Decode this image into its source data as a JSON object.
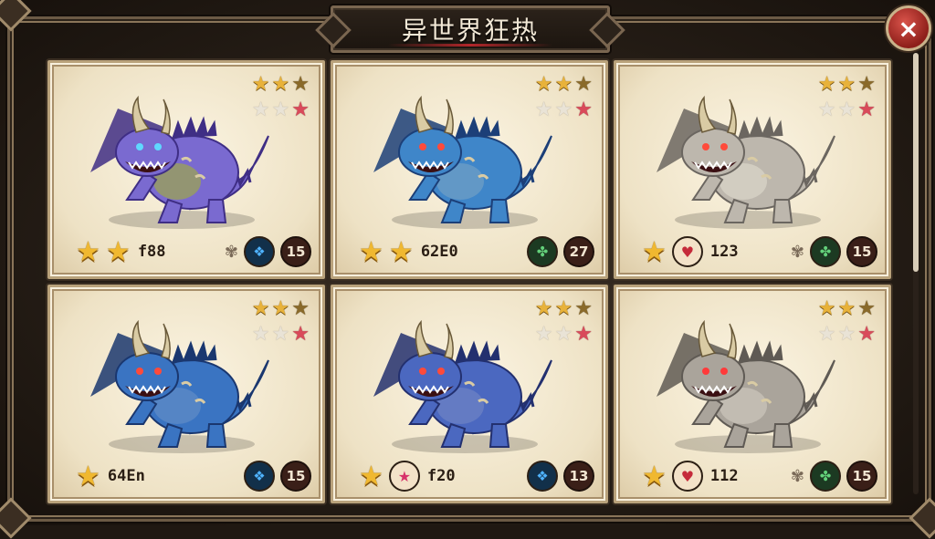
{
  "title": "异世界狂热",
  "close_icon": "×",
  "cards": [
    {
      "body": "#7a6ad0",
      "dark": "#3f2e85",
      "belly": "#9aa05a",
      "eye": "#5fd8ff",
      "top_rows": [
        [
          "gold",
          "gold",
          "dark"
        ],
        [
          "blank",
          "blank",
          "red"
        ]
      ],
      "bottom_stars": 2,
      "special_icon": null,
      "code": "f88",
      "leaf": true,
      "element": "blue",
      "element_glyph": "❖",
      "level": "15"
    },
    {
      "body": "#3f86c9",
      "dark": "#1c3f78",
      "belly": "#6c9cc6",
      "eye": "#ff4a3a",
      "top_rows": [
        [
          "gold",
          "gold",
          "dark"
        ],
        [
          "blank",
          "blank",
          "red"
        ]
      ],
      "bottom_stars": 2,
      "special_icon": null,
      "code": "62E0",
      "leaf": false,
      "element": "green",
      "element_glyph": "✤",
      "level": "27"
    },
    {
      "body": "#bdb7ad",
      "dark": "#6b6660",
      "belly": "#d7d2c6",
      "eye": "#ff4a3a",
      "top_rows": [
        [
          "gold",
          "gold",
          "dark"
        ],
        [
          "blank",
          "blank",
          "red"
        ]
      ],
      "bottom_stars": 1,
      "special_icon": "heart",
      "code": "123",
      "leaf": true,
      "element": "green",
      "element_glyph": "✤",
      "level": "15"
    },
    {
      "body": "#3a74c2",
      "dark": "#1a376f",
      "belly": "#5d89c5",
      "eye": "#ff4a3a",
      "top_rows": [
        [
          "gold",
          "gold",
          "dark"
        ],
        [
          "blank",
          "blank",
          "red"
        ]
      ],
      "bottom_stars": 1,
      "special_icon": null,
      "code": "64En",
      "leaf": false,
      "element": "blue",
      "element_glyph": "❖",
      "level": "15"
    },
    {
      "body": "#4b68c0",
      "dark": "#23306f",
      "belly": "#6a7fc3",
      "eye": "#ff4a3a",
      "top_rows": [
        [
          "gold",
          "gold",
          "dark"
        ],
        [
          "blank",
          "blank",
          "red"
        ]
      ],
      "bottom_stars": 1,
      "special_icon": "pinkstar",
      "code": "f20",
      "leaf": false,
      "element": "blue",
      "element_glyph": "❖",
      "level": "13"
    },
    {
      "body": "#aaa49b",
      "dark": "#5f5a54",
      "belly": "#c8c2b8",
      "eye": "#ff3a3a",
      "top_rows": [
        [
          "gold",
          "gold",
          "dark"
        ],
        [
          "blank",
          "blank",
          "red"
        ]
      ],
      "bottom_stars": 1,
      "special_icon": "heart",
      "code": "112",
      "leaf": true,
      "element": "green",
      "element_glyph": "✤",
      "level": "15"
    }
  ]
}
